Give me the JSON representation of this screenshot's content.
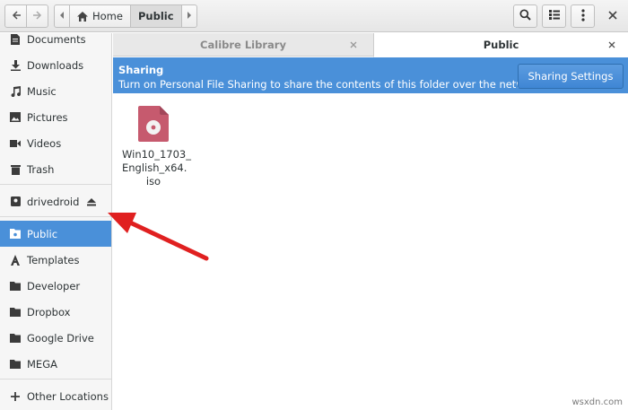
{
  "header": {
    "back_icon": "arrow-left-icon",
    "forward_icon": "arrow-right-icon",
    "path": [
      "Home",
      "Public"
    ],
    "search_icon": "search-icon",
    "view_icon": "list-view-icon",
    "menu_icon": "kebab-menu-icon",
    "close_icon": "close-icon"
  },
  "sidebar": {
    "items": [
      {
        "label": "Documents",
        "icon": "document-icon"
      },
      {
        "label": "Downloads",
        "icon": "download-icon"
      },
      {
        "label": "Music",
        "icon": "music-icon"
      },
      {
        "label": "Pictures",
        "icon": "picture-icon"
      },
      {
        "label": "Videos",
        "icon": "video-icon"
      },
      {
        "label": "Trash",
        "icon": "trash-icon"
      },
      {
        "label": "drivedroid",
        "icon": "drive-icon"
      },
      {
        "label": "Public",
        "icon": "folder-public-icon",
        "active": true
      },
      {
        "label": "Templates",
        "icon": "templates-icon"
      },
      {
        "label": "Developer",
        "icon": "folder-icon"
      },
      {
        "label": "Dropbox",
        "icon": "folder-icon"
      },
      {
        "label": "Google Drive",
        "icon": "folder-icon"
      },
      {
        "label": "MEGA",
        "icon": "folder-icon"
      },
      {
        "label": "Other Locations",
        "icon": "plus-icon"
      }
    ]
  },
  "tabs": [
    {
      "label": "Calibre Library"
    },
    {
      "label": "Public",
      "active": true
    }
  ],
  "banner": {
    "title": "Sharing",
    "text": "Turn on Personal File Sharing to share the contents of this folder over the network.",
    "button": "Sharing Settings"
  },
  "files": [
    {
      "name_lines": [
        "Win10_1703_",
        "English_x64.",
        "iso"
      ],
      "icon": "disc-image-icon"
    }
  ],
  "watermark": "wsxdn.com",
  "colors": {
    "accent": "#4a90d9",
    "annotation": "#e02020",
    "file_icon": "#c65a6e"
  }
}
